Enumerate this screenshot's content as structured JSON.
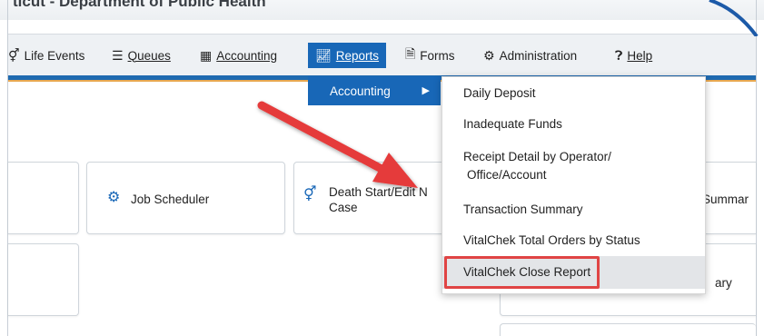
{
  "header": {
    "title": "ticut - Department of Public Health"
  },
  "nav": {
    "items": [
      {
        "label": "Life Events",
        "icon": "gender-icon",
        "underline_char": "e"
      },
      {
        "label": "Queues",
        "icon": "list-icon"
      },
      {
        "label": "Accounting",
        "icon": "calculator-icon"
      },
      {
        "label": "Reports",
        "icon": "chart-line-icon",
        "active": true
      },
      {
        "label": "Forms",
        "icon": "file-icon"
      },
      {
        "label": "Administration",
        "icon": "gear-icon"
      },
      {
        "label": "Help",
        "icon": "question-circle-icon"
      }
    ]
  },
  "submenu": {
    "label": "Accounting",
    "arrow": "▶"
  },
  "dropdown": {
    "items": [
      "Daily Deposit",
      "Inadequate Funds",
      "Receipt Detail by Operator/",
      "Office/Account",
      "Transaction Summary",
      "VitalChek Total Orders by Status",
      "VitalChek Close Report"
    ]
  },
  "tiles": {
    "job_scheduler": "Job Scheduler",
    "death_line1": "Death Start/Edit N",
    "death_line2": "Case",
    "summary_partial": "Summar",
    "ary_partial": "ary"
  },
  "colors": {
    "accent_blue": "#1867b7",
    "highlight_red": "#e04444",
    "nav_bg": "#eef1f4"
  }
}
